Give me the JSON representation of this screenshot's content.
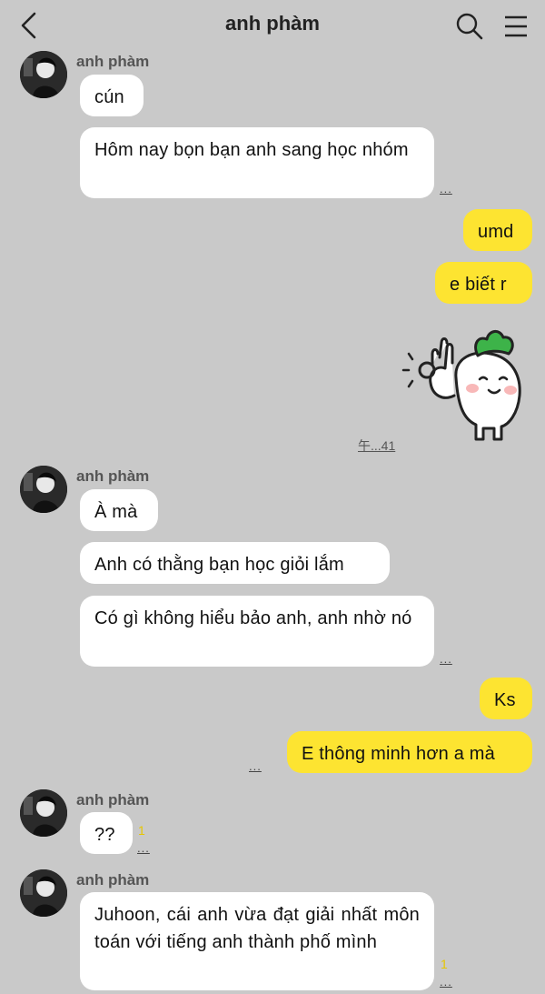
{
  "header": {
    "title": "anh phàm"
  },
  "messages": [
    {
      "sender": "anh phàm",
      "text": "cún"
    },
    {
      "text": "Hôm nay bọn bạn anh sang học nhóm",
      "meta": "..."
    },
    {
      "text": "umd"
    },
    {
      "text": "e biết r"
    },
    {
      "type": "sticker",
      "icon": "smiling-radish-ok-sticker",
      "meta": "午...41"
    },
    {
      "sender": "anh phàm",
      "text": "À mà"
    },
    {
      "text": "Anh có thằng bạn học giỏi lắm"
    },
    {
      "text": "Có gì không hiểu bảo anh, anh nhờ nó",
      "meta": "..."
    },
    {
      "text": "Ks"
    },
    {
      "text": "E thông minh hơn a mà",
      "meta": "..."
    },
    {
      "sender": "anh phàm",
      "text": "??",
      "unread": "1",
      "meta": "..."
    },
    {
      "sender": "anh phàm",
      "text": "Juhoon, cái anh vừa đạt giải nhất môn toán với tiếng anh thành phố mình",
      "unread": "1",
      "meta": "..."
    }
  ],
  "colors": {
    "background": "#c9c9c9",
    "incoming_bubble": "#ffffff",
    "outgoing_bubble": "#fde431",
    "unread": "#e6c600"
  }
}
